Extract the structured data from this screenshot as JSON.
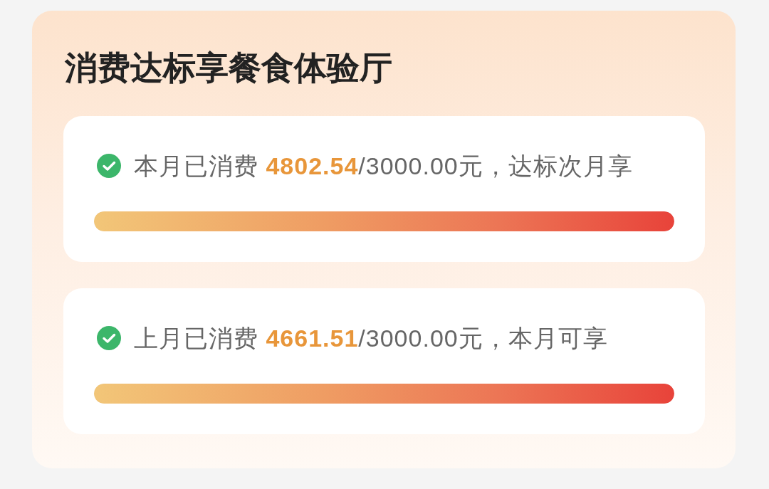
{
  "title": "消费达标享餐食体验厅",
  "items": [
    {
      "met": true,
      "label": "本月已消费",
      "amount": "4802.54",
      "rest": "/3000.00元，达标次月享",
      "level": 1
    },
    {
      "met": true,
      "label": "上月已消费",
      "amount": "4661.51",
      "rest": "/3000.00元，本月可享",
      "level": 1
    }
  ]
}
